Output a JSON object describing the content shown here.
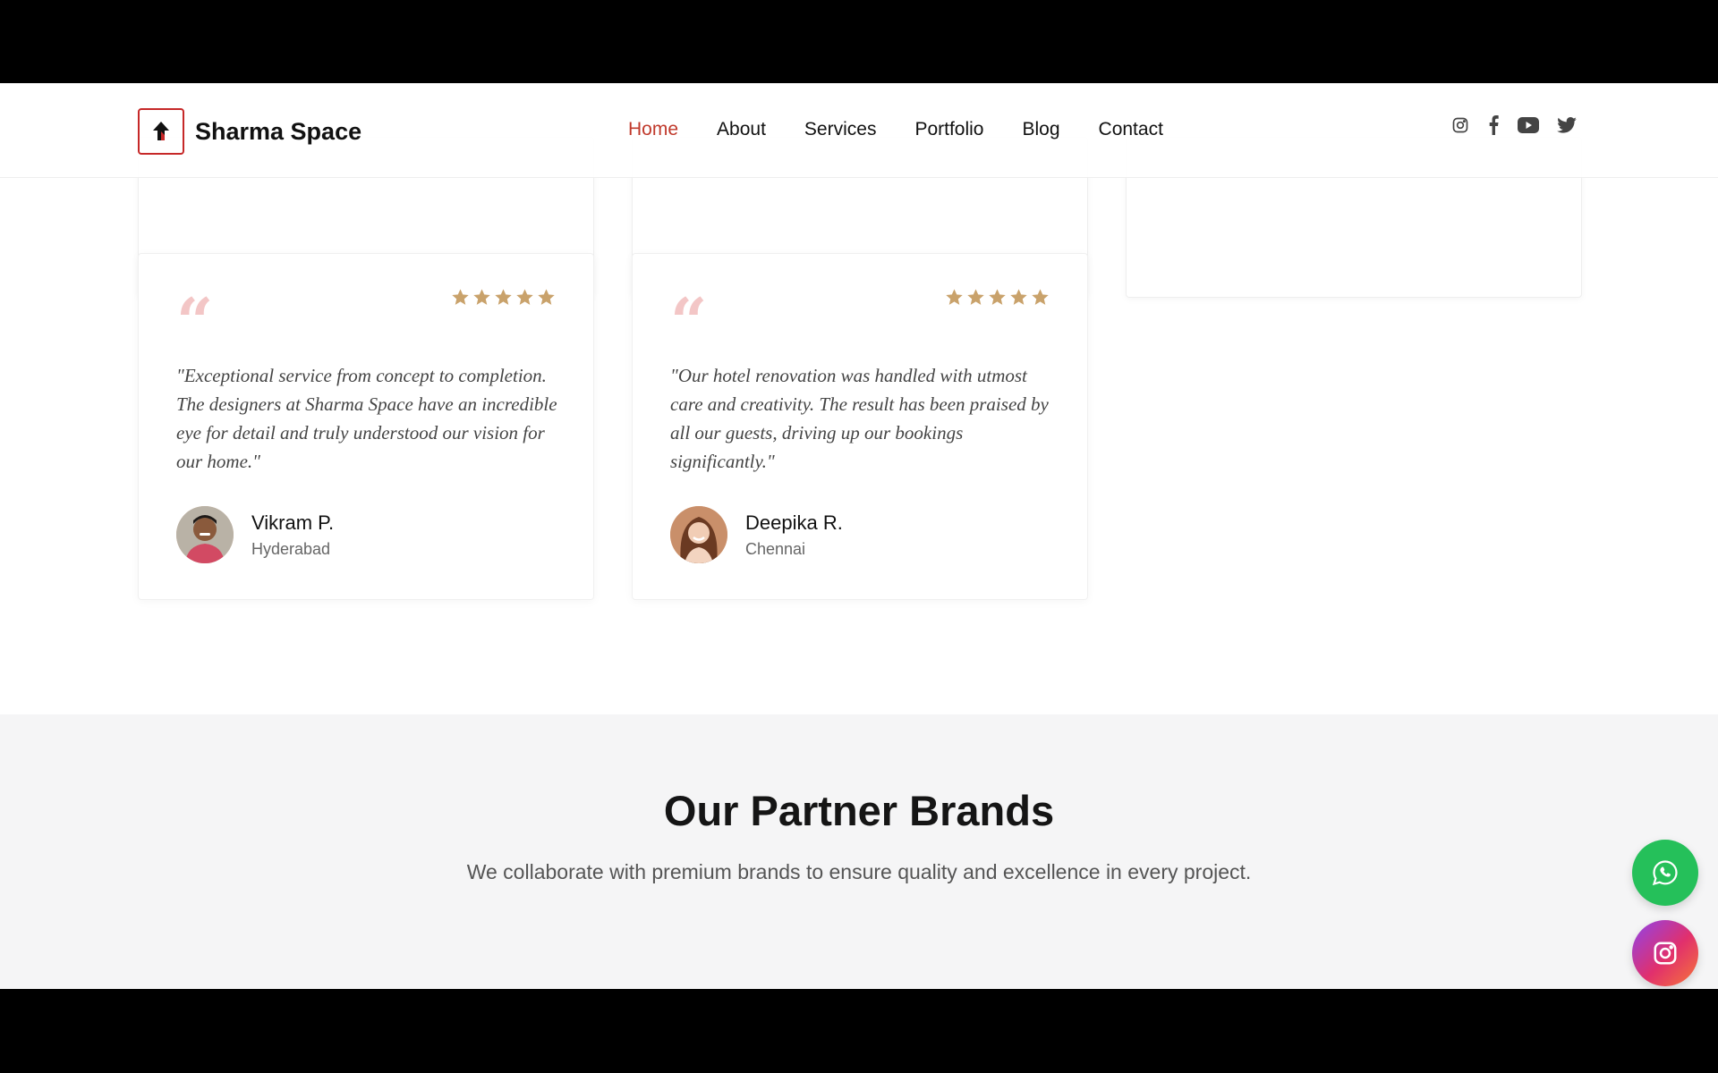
{
  "brand": {
    "name": "Sharma Space",
    "accent": "#c62828"
  },
  "nav": {
    "items": [
      {
        "label": "Home",
        "active": true
      },
      {
        "label": "About",
        "active": false
      },
      {
        "label": "Services",
        "active": false
      },
      {
        "label": "Portfolio",
        "active": false
      },
      {
        "label": "Blog",
        "active": false
      },
      {
        "label": "Contact",
        "active": false
      }
    ]
  },
  "social": {
    "icons": [
      "instagram-icon",
      "facebook-icon",
      "youtube-icon",
      "twitter-icon"
    ]
  },
  "testimonials": [
    {
      "rating": 5,
      "text": "\"Exceptional service from concept to completion. The designers at Sharma Space have an incredible eye for detail and truly understood our vision for our home.\"",
      "name": "Vikram P.",
      "city": "Hyderabad"
    },
    {
      "rating": 5,
      "text": "\"Our hotel renovation was handled with utmost care and creativity. The result has been praised by all our guests, driving up our bookings significantly.\"",
      "name": "Deepika R.",
      "city": "Chennai"
    }
  ],
  "partners": {
    "title": "Our Partner Brands",
    "subtitle": "We collaborate with premium brands to ensure quality and excellence in every project."
  },
  "floating": {
    "whatsapp_color": "#25c05a",
    "icons": [
      "whatsapp-icon",
      "instagram-icon"
    ]
  },
  "colors": {
    "star": "#c9a26b",
    "quote": "#f3c6c6",
    "nav_active": "#c0392b"
  }
}
